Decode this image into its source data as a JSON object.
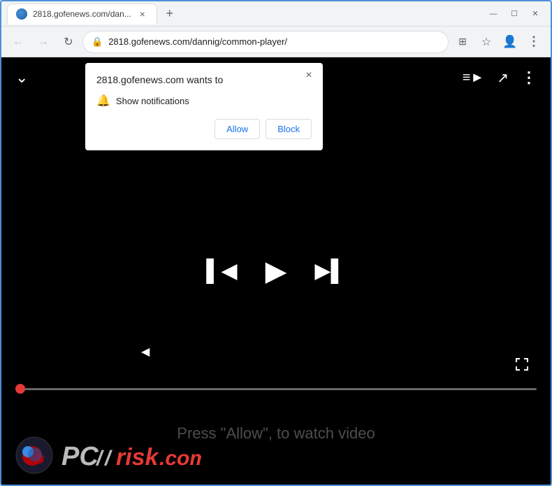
{
  "browser": {
    "title": "2818.gofenews.com/dan...",
    "url": "2818.gofenews.com/dannig/common-player/",
    "tab_close": "×",
    "new_tab": "+",
    "window_controls": {
      "minimize": "—",
      "maximize": "☐",
      "close": "✕"
    }
  },
  "popup": {
    "title": "2818.gofenews.com wants to",
    "notification_text": "Show notifications",
    "allow_label": "Allow",
    "block_label": "Block",
    "close": "×"
  },
  "player": {
    "message": "Press \"Allow\", to watch video"
  },
  "logo": {
    "pc": "PC",
    "slash": "ℛ",
    "risk": "risk",
    "dot_com": ".com"
  },
  "icons": {
    "back": "←",
    "forward": "→",
    "refresh": "↻",
    "lock": "🔒",
    "star": "☆",
    "account": "👤",
    "menu": "⋮",
    "apps": "⊞",
    "chevron_down": "⌄",
    "queue": "≡►",
    "share": "↗",
    "more_vert": "⋮",
    "skip_prev": "⏮",
    "play": "▶",
    "skip_next": "⏭",
    "fullscreen": "⛶",
    "bell": "🔔",
    "extensions": "⬡"
  }
}
